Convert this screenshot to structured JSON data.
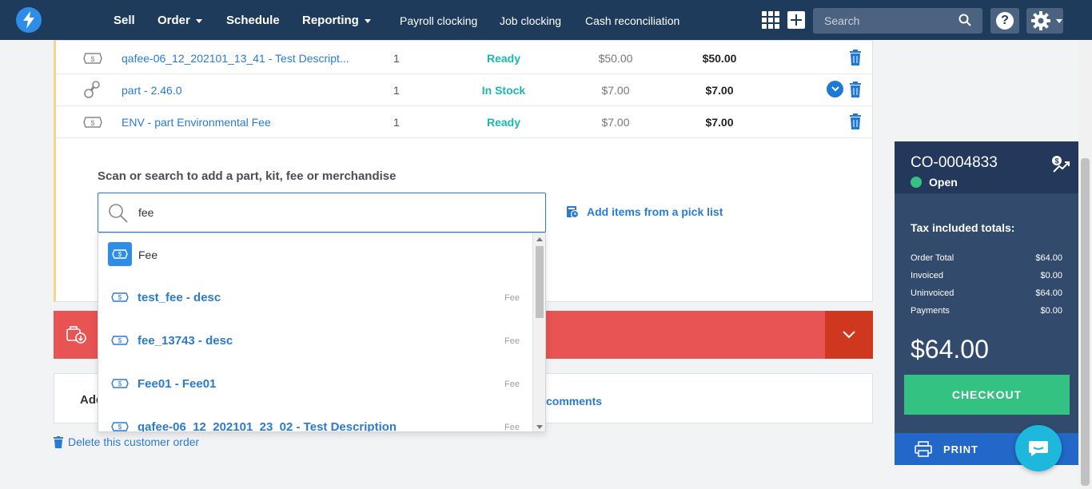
{
  "nav": {
    "items": [
      {
        "label": "Sell"
      },
      {
        "label": "Order"
      },
      {
        "label": "Schedule"
      },
      {
        "label": "Reporting"
      },
      {
        "label": "Payroll clocking"
      },
      {
        "label": "Job clocking"
      },
      {
        "label": "Cash reconciliation"
      }
    ],
    "search_placeholder": "Search",
    "help_label": "?"
  },
  "line_items": [
    {
      "icon": "fee-icon",
      "name": "qafee-06_12_202101_13_41 - Test Descript...",
      "qty": "1",
      "status": "Ready",
      "price": "$50.00",
      "total": "$50.00"
    },
    {
      "icon": "part-icon",
      "name": "part - 2.46.0",
      "qty": "1",
      "status": "In Stock",
      "price": "$7.00",
      "total": "$7.00"
    },
    {
      "icon": "fee-icon",
      "name": "ENV - part Environmental Fee",
      "qty": "1",
      "status": "Ready",
      "price": "$7.00",
      "total": "$7.00"
    }
  ],
  "scan": {
    "label": "Scan or search to add a part, kit, fee or merchandise",
    "value": "fee",
    "picklist_label": "Add items from a pick list"
  },
  "dropdown": {
    "header": "Fee",
    "items": [
      {
        "name": "test_fee - desc",
        "type": "Fee"
      },
      {
        "name": "fee_13743 - desc",
        "type": "Fee"
      },
      {
        "name": "Fee01 - Fee01",
        "type": "Fee"
      },
      {
        "name": "qafee-06_12_202101_23_02 - Test Description",
        "type": "Fee"
      }
    ]
  },
  "comments": {
    "add_label": "Add",
    "link_label": "comments"
  },
  "delete_label": "Delete this customer order",
  "order": {
    "id": "CO-0004833",
    "status": "Open",
    "tax_title": "Tax included totals:",
    "summary": [
      {
        "label": "Order Total",
        "value": "$64.00"
      },
      {
        "label": "Invoiced",
        "value": "$0.00"
      },
      {
        "label": "Uninvoiced",
        "value": "$64.00"
      },
      {
        "label": "Payments",
        "value": "$0.00"
      }
    ],
    "big_total": "$64.00",
    "checkout_label": "CHECKOUT",
    "print_label": "PRINT"
  },
  "colors": {
    "nav_bg": "#1f3b5c",
    "link_blue": "#2a7ad4",
    "ready_teal": "#19b7b0",
    "alert_red": "#e85353",
    "checkout_green": "#34c283",
    "panel_bg": "#324a6b"
  }
}
